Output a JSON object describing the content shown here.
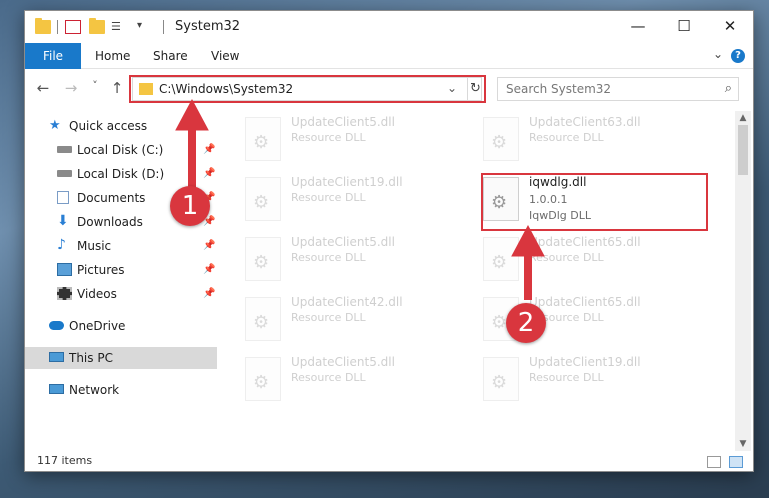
{
  "window": {
    "title": "System32",
    "controls": {
      "minimize": "—",
      "maximize": "☐",
      "close": "✕"
    }
  },
  "ribbon": {
    "file_tab": "File",
    "tabs": [
      "Home",
      "Share",
      "View"
    ],
    "help": "?"
  },
  "nav": {
    "back": "←",
    "forward": "→",
    "recent": "˅",
    "up": "↑",
    "address": "C:\\Windows\\System32",
    "search_placeholder": "Search System32"
  },
  "sidebar": {
    "items": [
      {
        "label": "Quick access",
        "icon": "star-icon"
      },
      {
        "label": "Local Disk (C:)",
        "icon": "drive-icon",
        "pinned": true
      },
      {
        "label": "Local Disk (D:)",
        "icon": "drive-icon",
        "pinned": true
      },
      {
        "label": "Documents",
        "icon": "documents-icon",
        "pinned": true
      },
      {
        "label": "Downloads",
        "icon": "downloads-icon",
        "pinned": true
      },
      {
        "label": "Music",
        "icon": "music-icon",
        "pinned": true
      },
      {
        "label": "Pictures",
        "icon": "pictures-icon",
        "pinned": true
      },
      {
        "label": "Videos",
        "icon": "videos-icon",
        "pinned": true
      },
      {
        "label": "OneDrive",
        "icon": "cloud-icon"
      },
      {
        "label": "This PC",
        "icon": "computer-icon",
        "selected": true
      },
      {
        "label": "Network",
        "icon": "network-icon"
      }
    ]
  },
  "files": {
    "left": [
      {
        "name": "UpdateClient5.dll",
        "type": "Resource DLL"
      },
      {
        "name": "UpdateClient19.dll",
        "type": "Resource DLL"
      },
      {
        "name": "UpdateClient5.dll",
        "type": "Resource DLL"
      },
      {
        "name": "UpdateClient42.dll",
        "type": "Resource DLL"
      },
      {
        "name": "UpdateClient5.dll",
        "type": "Resource DLL"
      }
    ],
    "right": [
      {
        "name": "UpdateClient63.dll",
        "type": "Resource DLL"
      },
      {
        "name": "UpdateClient65.dll",
        "type": "Resource DLL"
      },
      {
        "name": "UpdateClient65.dll",
        "type": "Resource DLL"
      },
      {
        "name": "UpdateClient19.dll",
        "type": "Resource DLL"
      }
    ],
    "highlighted": {
      "name": "iqwdlg.dll",
      "version": "1.0.0.1",
      "description": "IqwDlg DLL"
    }
  },
  "status": {
    "item_count": "117 items"
  },
  "callouts": [
    "1",
    "2"
  ],
  "colors": {
    "accent": "#1979ca",
    "highlight": "#d9363e",
    "folder": "#f4c542"
  }
}
